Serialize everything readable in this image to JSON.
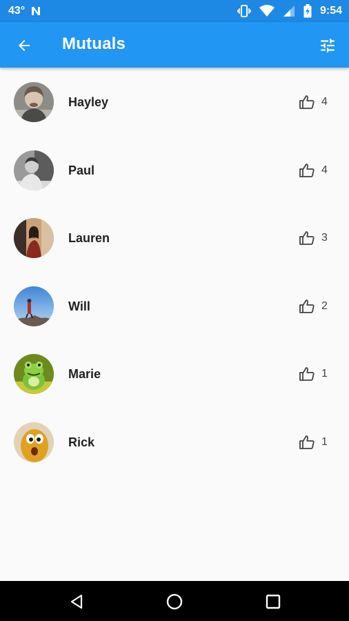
{
  "status_bar": {
    "temperature": "43°",
    "time": "9:54",
    "icons": [
      "notification-n-icon",
      "vibrate-icon",
      "wifi-icon",
      "cell-signal-icon",
      "battery-icon"
    ]
  },
  "app_bar": {
    "title": "Mutuals",
    "back_icon": "arrow-back-icon",
    "filter_icon": "tune-sliders-icon",
    "color": "#2196f3"
  },
  "people": [
    {
      "name": "Hayley",
      "likes": "4"
    },
    {
      "name": "Paul",
      "likes": "4"
    },
    {
      "name": "Lauren",
      "likes": "3"
    },
    {
      "name": "Will",
      "likes": "2"
    },
    {
      "name": "Marie",
      "likes": "1"
    },
    {
      "name": "Rick",
      "likes": "1"
    }
  ],
  "nav_bar": {
    "buttons": [
      "back-triangle-icon",
      "home-circle-icon",
      "recents-square-icon"
    ]
  }
}
